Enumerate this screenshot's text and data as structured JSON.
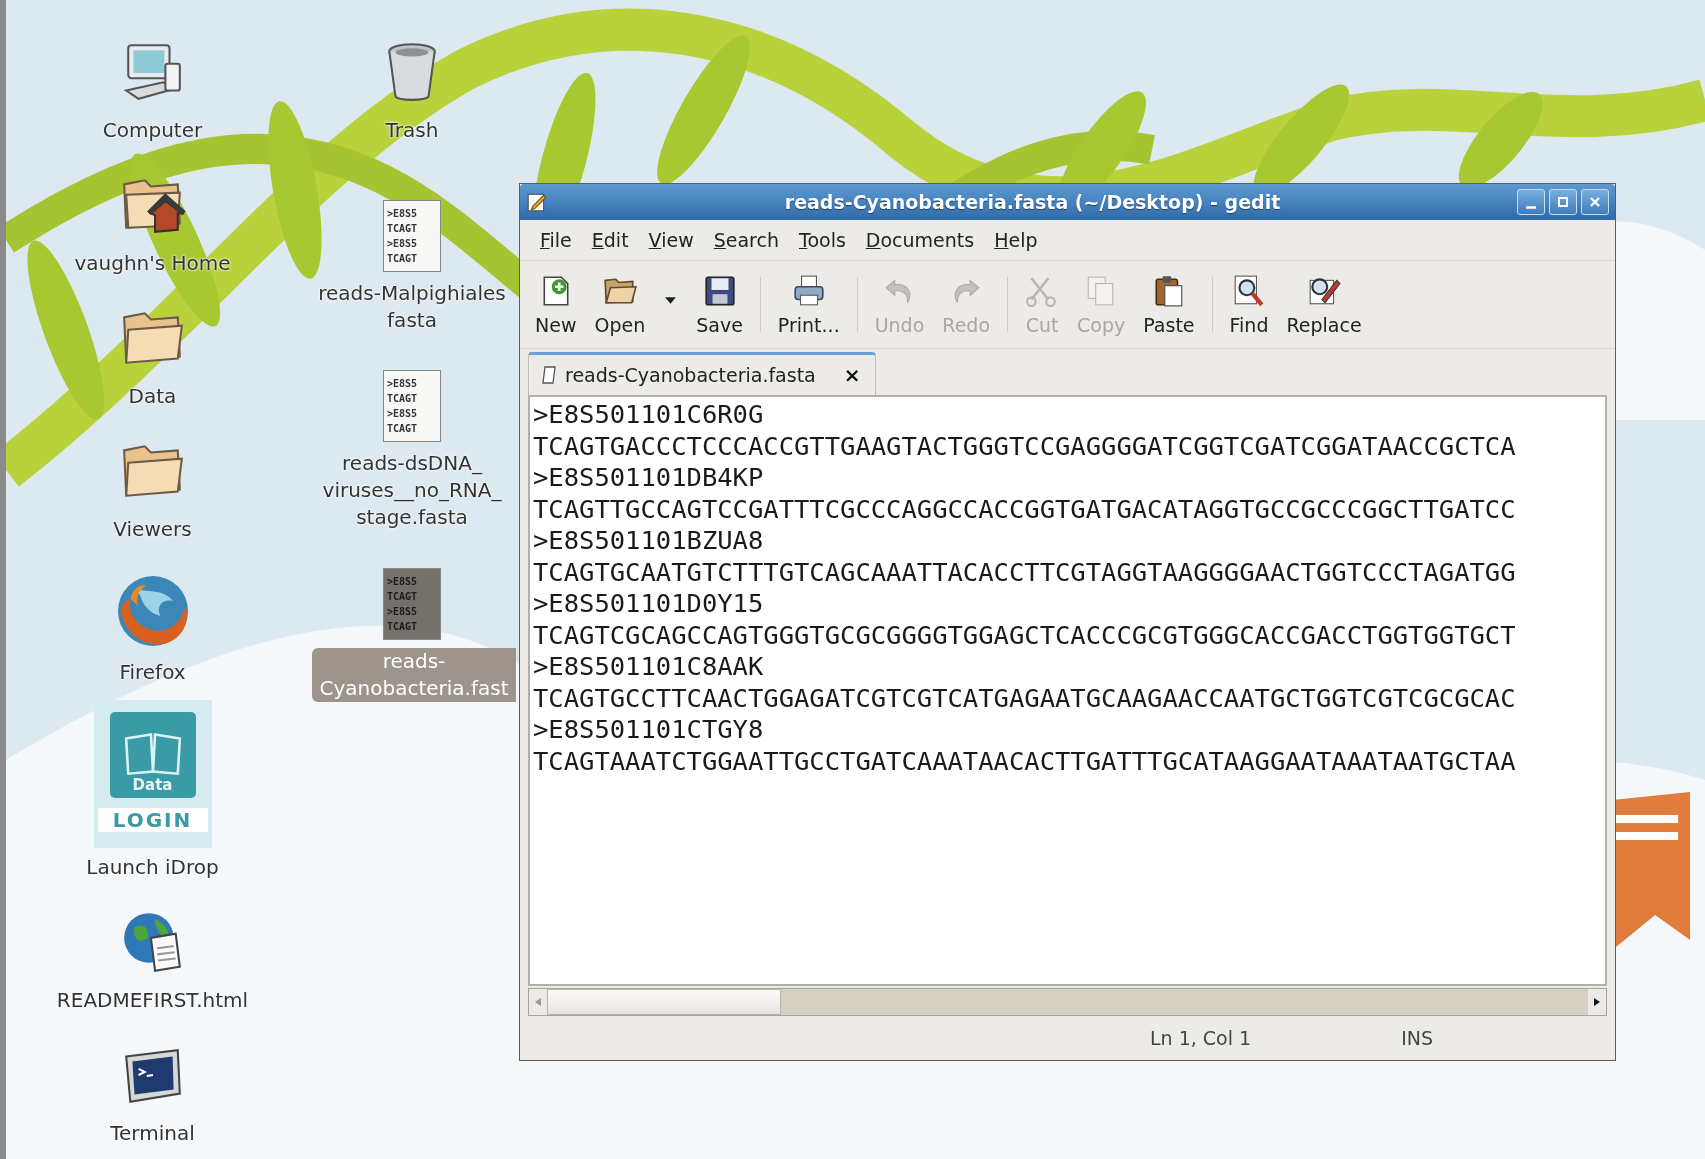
{
  "desktop": {
    "columns": [
      {
        "items": [
          {
            "kind": "icon",
            "label": [
              "Computer"
            ],
            "selected": false
          },
          {
            "kind": "icon",
            "label": [
              "vaughn's Home"
            ],
            "selected": false
          },
          {
            "kind": "icon",
            "label": [
              "Data"
            ],
            "selected": false
          },
          {
            "kind": "icon",
            "label": [
              "Viewers"
            ],
            "selected": false
          },
          {
            "kind": "icon",
            "label": [
              "Firefox"
            ],
            "selected": false
          },
          {
            "kind": "launcher",
            "badge": "Data",
            "button": "LOGIN",
            "label": [
              "Launch iDrop"
            ],
            "selected": false
          },
          {
            "kind": "icon",
            "label": [
              "READMEFIRST.html"
            ],
            "selected": false
          },
          {
            "kind": "icon",
            "label": [
              "Terminal"
            ],
            "selected": false
          }
        ]
      },
      {
        "items": [
          {
            "kind": "icon",
            "label": [
              "Trash"
            ],
            "selected": false
          },
          {
            "kind": "file",
            "preview": [
              ">E8S5",
              "TCAGT",
              ">E8S5",
              "TCAGT"
            ],
            "label": [
              "reads-Malpighiales",
              "fasta"
            ],
            "selected": false
          },
          {
            "kind": "file",
            "preview": [
              ">E8S5",
              "TCAGT",
              ">E8S5",
              "TCAGT"
            ],
            "label": [
              "reads-dsDNA_",
              "viruses__no_RNA_",
              "stage.fasta"
            ],
            "selected": false
          },
          {
            "kind": "file",
            "preview": [
              ">E8S5",
              "TCAGT",
              ">E8S5",
              "TCAGT"
            ],
            "label": [
              "reads-",
              "Cyanobacteria.fast"
            ],
            "selected": true
          }
        ]
      }
    ]
  },
  "window": {
    "title": "reads-Cyanobacteria.fasta (~/Desktop) - gedit",
    "menu": [
      "File",
      "Edit",
      "View",
      "Search",
      "Tools",
      "Documents",
      "Help"
    ],
    "toolbar": [
      {
        "kind": "button",
        "label": "New",
        "disabled": false
      },
      {
        "kind": "button",
        "label": "Open",
        "disabled": false
      },
      {
        "kind": "dropdown",
        "disabled": false
      },
      {
        "kind": "button",
        "label": "Save",
        "disabled": false
      },
      {
        "kind": "separator"
      },
      {
        "kind": "button",
        "label": "Print...",
        "disabled": false
      },
      {
        "kind": "separator"
      },
      {
        "kind": "button",
        "label": "Undo",
        "disabled": true
      },
      {
        "kind": "button",
        "label": "Redo",
        "disabled": true
      },
      {
        "kind": "separator"
      },
      {
        "kind": "button",
        "label": "Cut",
        "disabled": true
      },
      {
        "kind": "button",
        "label": "Copy",
        "disabled": true
      },
      {
        "kind": "button",
        "label": "Paste",
        "disabled": false
      },
      {
        "kind": "separator"
      },
      {
        "kind": "button",
        "label": "Find",
        "disabled": false
      },
      {
        "kind": "button",
        "label": "Replace",
        "disabled": false
      }
    ],
    "tabs": [
      {
        "label": "reads-Cyanobacteria.fasta",
        "close": "×",
        "selected": true
      }
    ],
    "editor": {
      "lines": [
        ">E8S501101C6R0G",
        "TCAGTGACCCTCCCACCGTTGAAGTACTGGGTCCGAGGGGATCGGTCGATCGGATAACCGCTCA",
        ">E8S501101DB4KP",
        "TCAGTTGCCAGTCCGATTTCGCCCAGGCCACCGGTGATGACATAGGTGCCGCCCGGCTTGATCC",
        ">E8S501101BZUA8",
        "TCAGTGCAATGTCTTTGTCAGCAAATTACACCTTCGTAGGTAAGGGGAACTGGTCCCTAGATGG",
        ">E8S501101D0Y15",
        "TCAGTCGCAGCCAGTGGGTGCGCGGGGTGGAGCTCACCCGCGTGGGCACCGACCTGGTGGTGCT",
        ">E8S501101C8AAK",
        "TCAGTGCCTTCAACTGGAGATCGTCGTCATGAGAATGCAAGAACCAATGCTGGTCGTCGCGCAC",
        ">E8S501101CTGY8",
        "TCAGTAAATCTGGAATTGCCTGATCAAATAACACTTGATTTGCATAAGGAATAAATAATGCTAA"
      ]
    },
    "status_bar": {
      "position": "Ln 1, Col 1",
      "mode": "INS"
    }
  }
}
